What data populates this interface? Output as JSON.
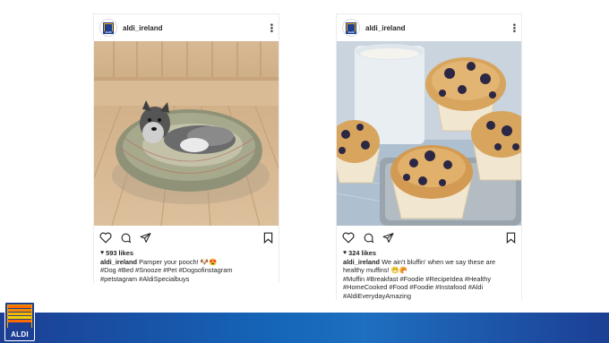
{
  "brand": {
    "logo_text": "ALDI"
  },
  "posts": [
    {
      "username": "aldi_ireland",
      "likes": "593 likes",
      "caption_user": "aldi_ireland",
      "caption_text": " Pamper your pooch! 🐶😍",
      "hashtags": [
        "#Dog #Bed #Snooze #Pet #Dogsofinstagram",
        "#petstagram #AldiSpecialbuys"
      ]
    },
    {
      "username": "aldi_ireland",
      "likes": "324 likes",
      "caption_user": "aldi_ireland",
      "caption_text": " We ain't bluffin' when we say these are",
      "caption_text2": "healthy muffins! 😁🥐",
      "hashtags": [
        "#Muffin #Breakfast #Foodie #RecipeIdea #Healthy",
        "#HomeCooked #Food #Foodie #Instafood #Aldi",
        "#AldiEverydayAmazing"
      ]
    }
  ]
}
